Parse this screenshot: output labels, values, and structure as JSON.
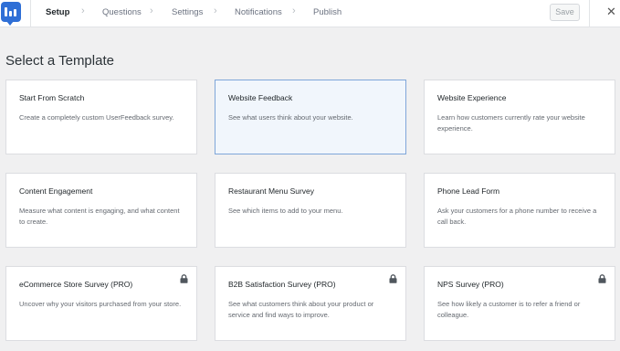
{
  "header": {
    "steps": [
      {
        "label": "Setup",
        "active": true
      },
      {
        "label": "Questions",
        "active": false
      },
      {
        "label": "Settings",
        "active": false
      },
      {
        "label": "Notifications",
        "active": false
      },
      {
        "label": "Publish",
        "active": false
      }
    ],
    "save_label": "Save",
    "close_icon": "close-icon",
    "logo_icon": "userfeedback-logo"
  },
  "page_title": "Select a Template",
  "colors": {
    "accent": "#2f6fd6",
    "selected_bg": "#f1f6fc",
    "selected_border": "#7fa6d9",
    "page_bg": "#f0f0f1"
  },
  "templates": [
    {
      "title": "Start From Scratch",
      "desc": "Create a completely custom UserFeedback survey.",
      "pro": false,
      "selected": false
    },
    {
      "title": "Website Feedback",
      "desc": "See what users think about your website.",
      "pro": false,
      "selected": true
    },
    {
      "title": "Website Experience",
      "desc": "Learn how customers currently rate your website experience.",
      "pro": false,
      "selected": false
    },
    {
      "title": "Content Engagement",
      "desc": "Measure what content is engaging, and what content to create.",
      "pro": false,
      "selected": false
    },
    {
      "title": "Restaurant Menu Survey",
      "desc": "See which items to add to your menu.",
      "pro": false,
      "selected": false
    },
    {
      "title": "Phone Lead Form",
      "desc": "Ask your customers for a phone number to receive a call back.",
      "pro": false,
      "selected": false
    },
    {
      "title": "eCommerce Store Survey (PRO)",
      "desc": "Uncover why your visitors purchased from your store.",
      "pro": true,
      "selected": false
    },
    {
      "title": "B2B Satisfaction Survey (PRO)",
      "desc": "See what customers think about your product or service and find ways to improve.",
      "pro": true,
      "selected": false
    },
    {
      "title": "NPS Survey (PRO)",
      "desc": "See how likely a customer is to refer a friend or colleague.",
      "pro": true,
      "selected": false
    }
  ]
}
